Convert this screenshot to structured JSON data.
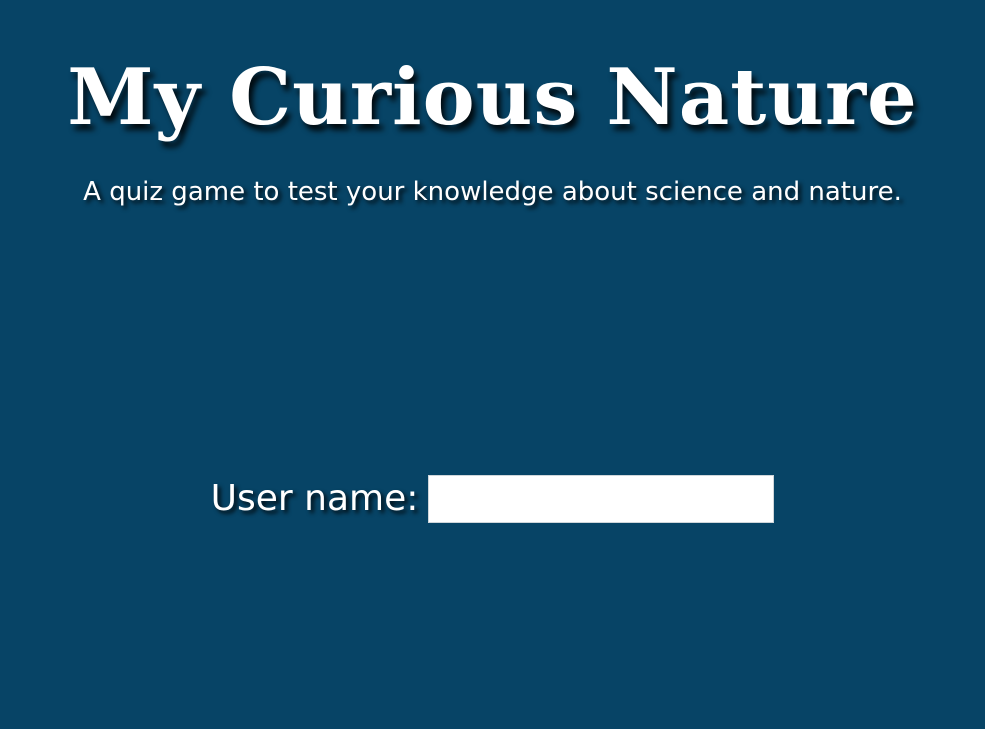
{
  "header": {
    "title": "My Curious Nature",
    "subtitle": "A quiz game to test your knowledge about science and nature."
  },
  "login": {
    "label": "User name:",
    "input_value": "",
    "input_placeholder": ""
  },
  "colors": {
    "background": "#074466",
    "text": "#ffffff",
    "input_background": "#ffffff"
  }
}
